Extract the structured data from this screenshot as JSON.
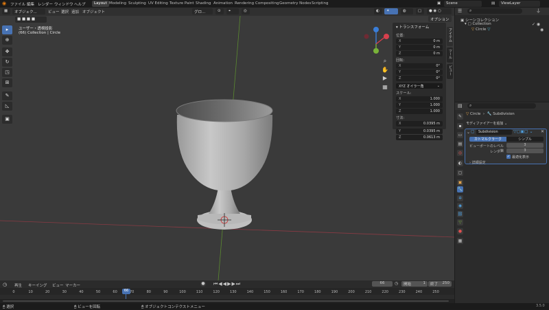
{
  "topbar": {
    "menu": [
      "ファイル",
      "編集",
      "レンダー",
      "ウィンドウ",
      "ヘルプ"
    ],
    "workspaces": [
      "Layout",
      "Modeling",
      "Sculpting",
      "UV Editing",
      "Texture Paint",
      "Shading",
      "Animation",
      "Rendering",
      "Compositing",
      "Geometry Nodes",
      "Scripting"
    ],
    "active_workspace": "Layout",
    "scene": "Scene",
    "view_layer": "ViewLayer"
  },
  "viewport": {
    "mode": "オブジェク...",
    "menu": [
      "ビュー",
      "選択",
      "追加",
      "オブジェクト"
    ],
    "transform_orient": "グロ...",
    "options_label": "オプション",
    "view_info": "ユーザー・透視投影",
    "object_info": "(66) Collection | Circle",
    "gizmo": {
      "x": "X",
      "y": "Y",
      "z": "Z"
    }
  },
  "npanel": {
    "title": "トランスフォーム",
    "location_label": "位置:",
    "location": [
      {
        "axis": "X",
        "value": "0 m"
      },
      {
        "axis": "Y",
        "value": "0 m"
      },
      {
        "axis": "Z",
        "value": "0 m"
      }
    ],
    "rotation_label": "回転:",
    "rotation": [
      {
        "axis": "X",
        "value": "0°"
      },
      {
        "axis": "Y",
        "value": "0°"
      },
      {
        "axis": "Z",
        "value": "0°"
      }
    ],
    "rotation_mode": "XYZ オイラー角",
    "scale_label": "スケール:",
    "scale": [
      {
        "axis": "X",
        "value": "1.000"
      },
      {
        "axis": "Y",
        "value": "1.000"
      },
      {
        "axis": "Z",
        "value": "1.000"
      }
    ],
    "dimensions_label": "寸法:",
    "dimensions": [
      {
        "axis": "X",
        "value": "0.0395 m"
      },
      {
        "axis": "Y",
        "value": "0.0395 m"
      },
      {
        "axis": "Z",
        "value": "0.0613 m"
      }
    ],
    "side_tabs": [
      "アイテム",
      "ツール",
      "ビュー"
    ]
  },
  "outliner": {
    "scene_collection": "シーンコレクション",
    "collection": "Collection",
    "object": "Circle"
  },
  "properties": {
    "breadcrumb_object": "Circle",
    "breadcrumb_modifier": "Subdivision",
    "add_modifier": "モディファイアーを追加",
    "modifier_name": "Subdivision",
    "tab_catmull": "カトマルクラーク",
    "tab_simple": "シンプル",
    "viewport_levels_label": "ビューポートのレベル数",
    "viewport_levels": "3",
    "render_label": "レンダー",
    "render_levels": "3",
    "optimal_display": "最適化表示",
    "advanced": "詳細設定"
  },
  "timeline": {
    "menu": [
      "再生",
      "キーイング",
      "ビュー",
      "マーカー"
    ],
    "current_frame": "66",
    "start_label": "開始",
    "start": "1",
    "end_label": "終了",
    "end": "250",
    "ticks": [
      "0",
      "10",
      "20",
      "30",
      "40",
      "50",
      "60",
      "70",
      "80",
      "90",
      "100",
      "110",
      "120",
      "130",
      "140",
      "150",
      "160",
      "170",
      "180",
      "190",
      "200",
      "210",
      "220",
      "230",
      "240",
      "250"
    ],
    "playhead": "66"
  },
  "statusbar": {
    "select": "選択",
    "rotate_view": "ビューを回転",
    "context_menu": "オブジェクトコンテクストメニュー",
    "version": "3.5.0"
  },
  "colors": {
    "accent": "#4772b3",
    "x_axis": "#d8404d",
    "y_axis": "#79b339",
    "z_axis": "#3a7ed8"
  }
}
